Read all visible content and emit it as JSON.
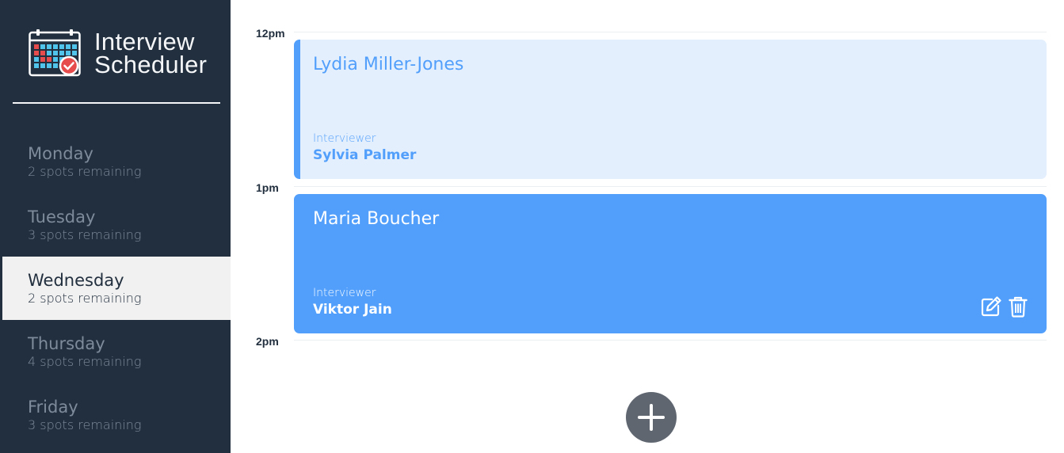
{
  "brand": {
    "line1": "Interview",
    "line2": "Scheduler",
    "icon": "calendar-check-icon"
  },
  "days": [
    {
      "name": "Monday",
      "spots": "2 spots remaining",
      "selected": false
    },
    {
      "name": "Tuesday",
      "spots": "3 spots remaining",
      "selected": false
    },
    {
      "name": "Wednesday",
      "spots": "2 spots remaining",
      "selected": true
    },
    {
      "name": "Thursday",
      "spots": "4 spots remaining",
      "selected": false
    },
    {
      "name": "Friday",
      "spots": "3 spots remaining",
      "selected": false
    }
  ],
  "schedule": {
    "times": [
      "12pm",
      "1pm",
      "2pm"
    ],
    "appointments": [
      {
        "time": "12pm",
        "student": "Lydia Miller-Jones",
        "interviewer_label": "Interviewer",
        "interviewer": "Sylvia Palmer",
        "hovered": false
      },
      {
        "time": "1pm",
        "student": "Maria Boucher",
        "interviewer_label": "Interviewer",
        "interviewer": "Viktor Jain",
        "hovered": true,
        "actions": [
          "edit-icon",
          "trash-icon"
        ]
      }
    ],
    "add_button_icon": "plus-icon"
  },
  "colors": {
    "sidebar_bg": "#222f3e",
    "accent": "#519ffb",
    "appointment_light_bg": "#e3effd",
    "selected_day_bg": "#f1f1f1",
    "add_button_bg": "#5f6670"
  }
}
